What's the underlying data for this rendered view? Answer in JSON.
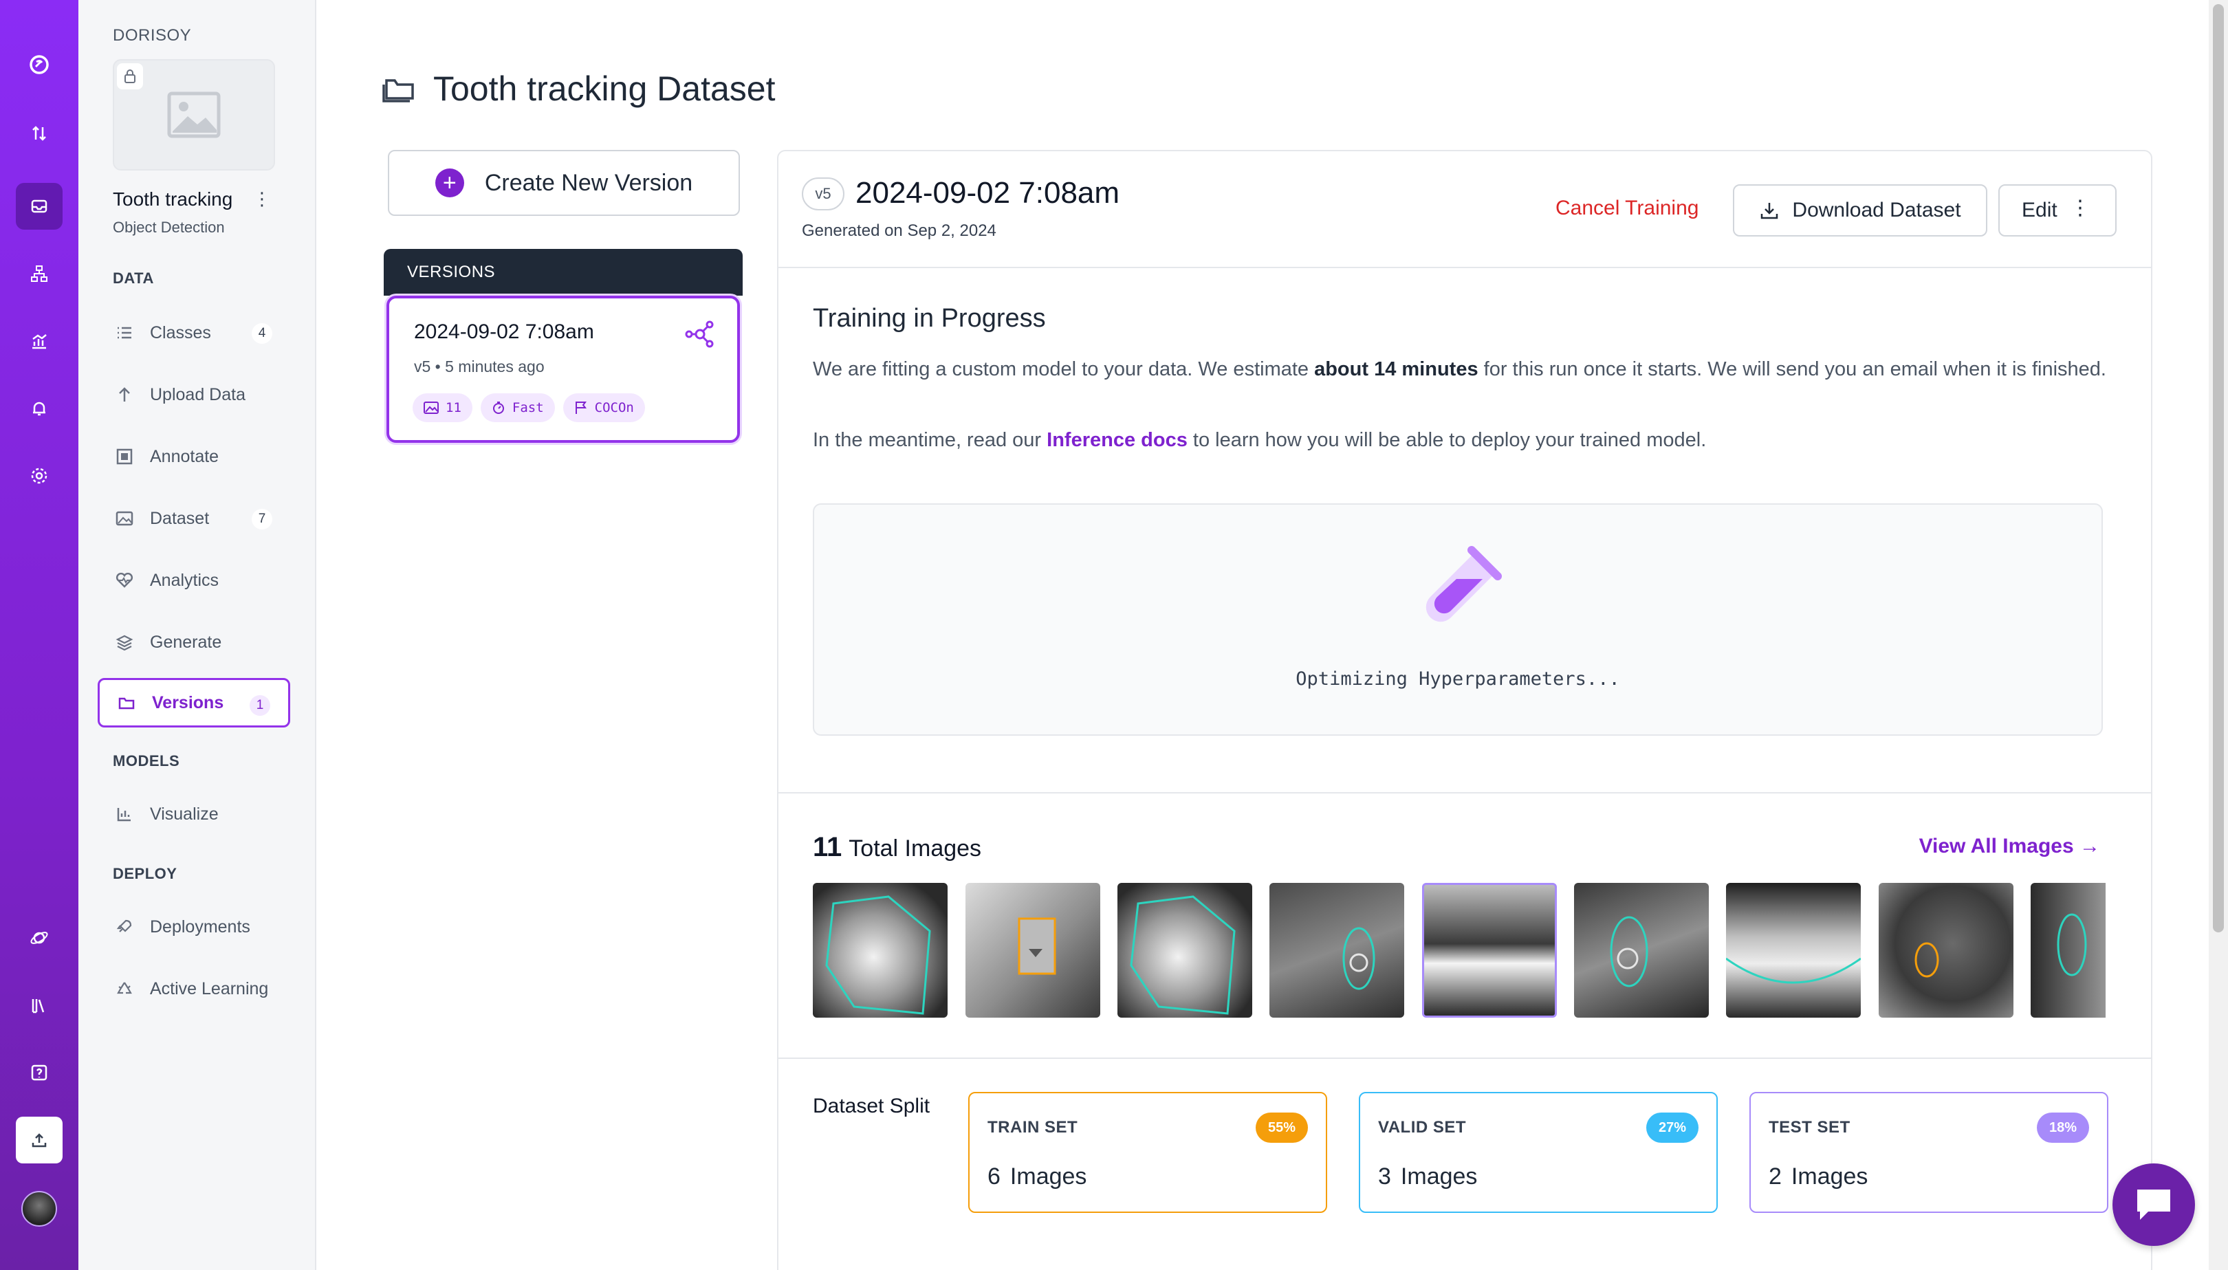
{
  "workspace": {
    "name": "DORISOY"
  },
  "project": {
    "name": "Tooth tracking",
    "type": "Object Detection"
  },
  "sidebar": {
    "sections": {
      "data": "DATA",
      "models": "MODELS",
      "deploy": "DEPLOY"
    },
    "items": [
      {
        "label": "Classes",
        "count": "4"
      },
      {
        "label": "Upload Data"
      },
      {
        "label": "Annotate"
      },
      {
        "label": "Dataset",
        "count": "7"
      },
      {
        "label": "Analytics"
      },
      {
        "label": "Generate"
      },
      {
        "label": "Versions",
        "count": "1"
      },
      {
        "label": "Visualize"
      },
      {
        "label": "Deployments"
      },
      {
        "label": "Active Learning"
      }
    ]
  },
  "page": {
    "title": "Tooth tracking Dataset"
  },
  "create_version": {
    "label": "Create New Version"
  },
  "versions": {
    "header": "VERSIONS",
    "list": [
      {
        "title": "2024-09-02 7:08am",
        "sub": "v5 • 5 minutes ago",
        "tags": {
          "images": "11",
          "speed": "Fast",
          "checkpoint": "COCOn"
        }
      }
    ]
  },
  "detail": {
    "badge": "v5",
    "title": "2024-09-02 7:08am",
    "generated": "Generated on Sep 2, 2024",
    "cancel": "Cancel Training",
    "download": "Download Dataset",
    "edit": "Edit",
    "training": {
      "title": "Training in Progress",
      "p1_a": "We are fitting a custom model to your data. We estimate ",
      "p1_b": "about 14 minutes",
      "p1_c": " for this run once it starts. We will send you an email when it is finished.",
      "p2_a": "In the meantime, read our ",
      "p2_link": "Inference docs",
      "p2_b": " to learn how you will be able to deploy your trained model.",
      "status": "Optimizing Hyperparameters..."
    },
    "images": {
      "count": "11",
      "label": "Total Images",
      "view_all": "View All Images →"
    },
    "split": {
      "label": "Dataset Split",
      "images_word": "Images",
      "sets": [
        {
          "name": "TRAIN SET",
          "pct": "55%",
          "count": "6",
          "border": "#f59e0b",
          "pill_bg": "#f59e0b",
          "pill_fg": "#ffffff"
        },
        {
          "name": "VALID SET",
          "pct": "27%",
          "count": "3",
          "border": "#38bdf8",
          "pill_bg": "#38bdf8",
          "pill_fg": "#ffffff"
        },
        {
          "name": "TEST SET",
          "pct": "18%",
          "count": "2",
          "border": "#a78bfa",
          "pill_bg": "#a78bfa",
          "pill_fg": "#ffffff"
        }
      ]
    }
  },
  "colors": {
    "accent": "#7e22ce",
    "danger": "#dc2626"
  }
}
